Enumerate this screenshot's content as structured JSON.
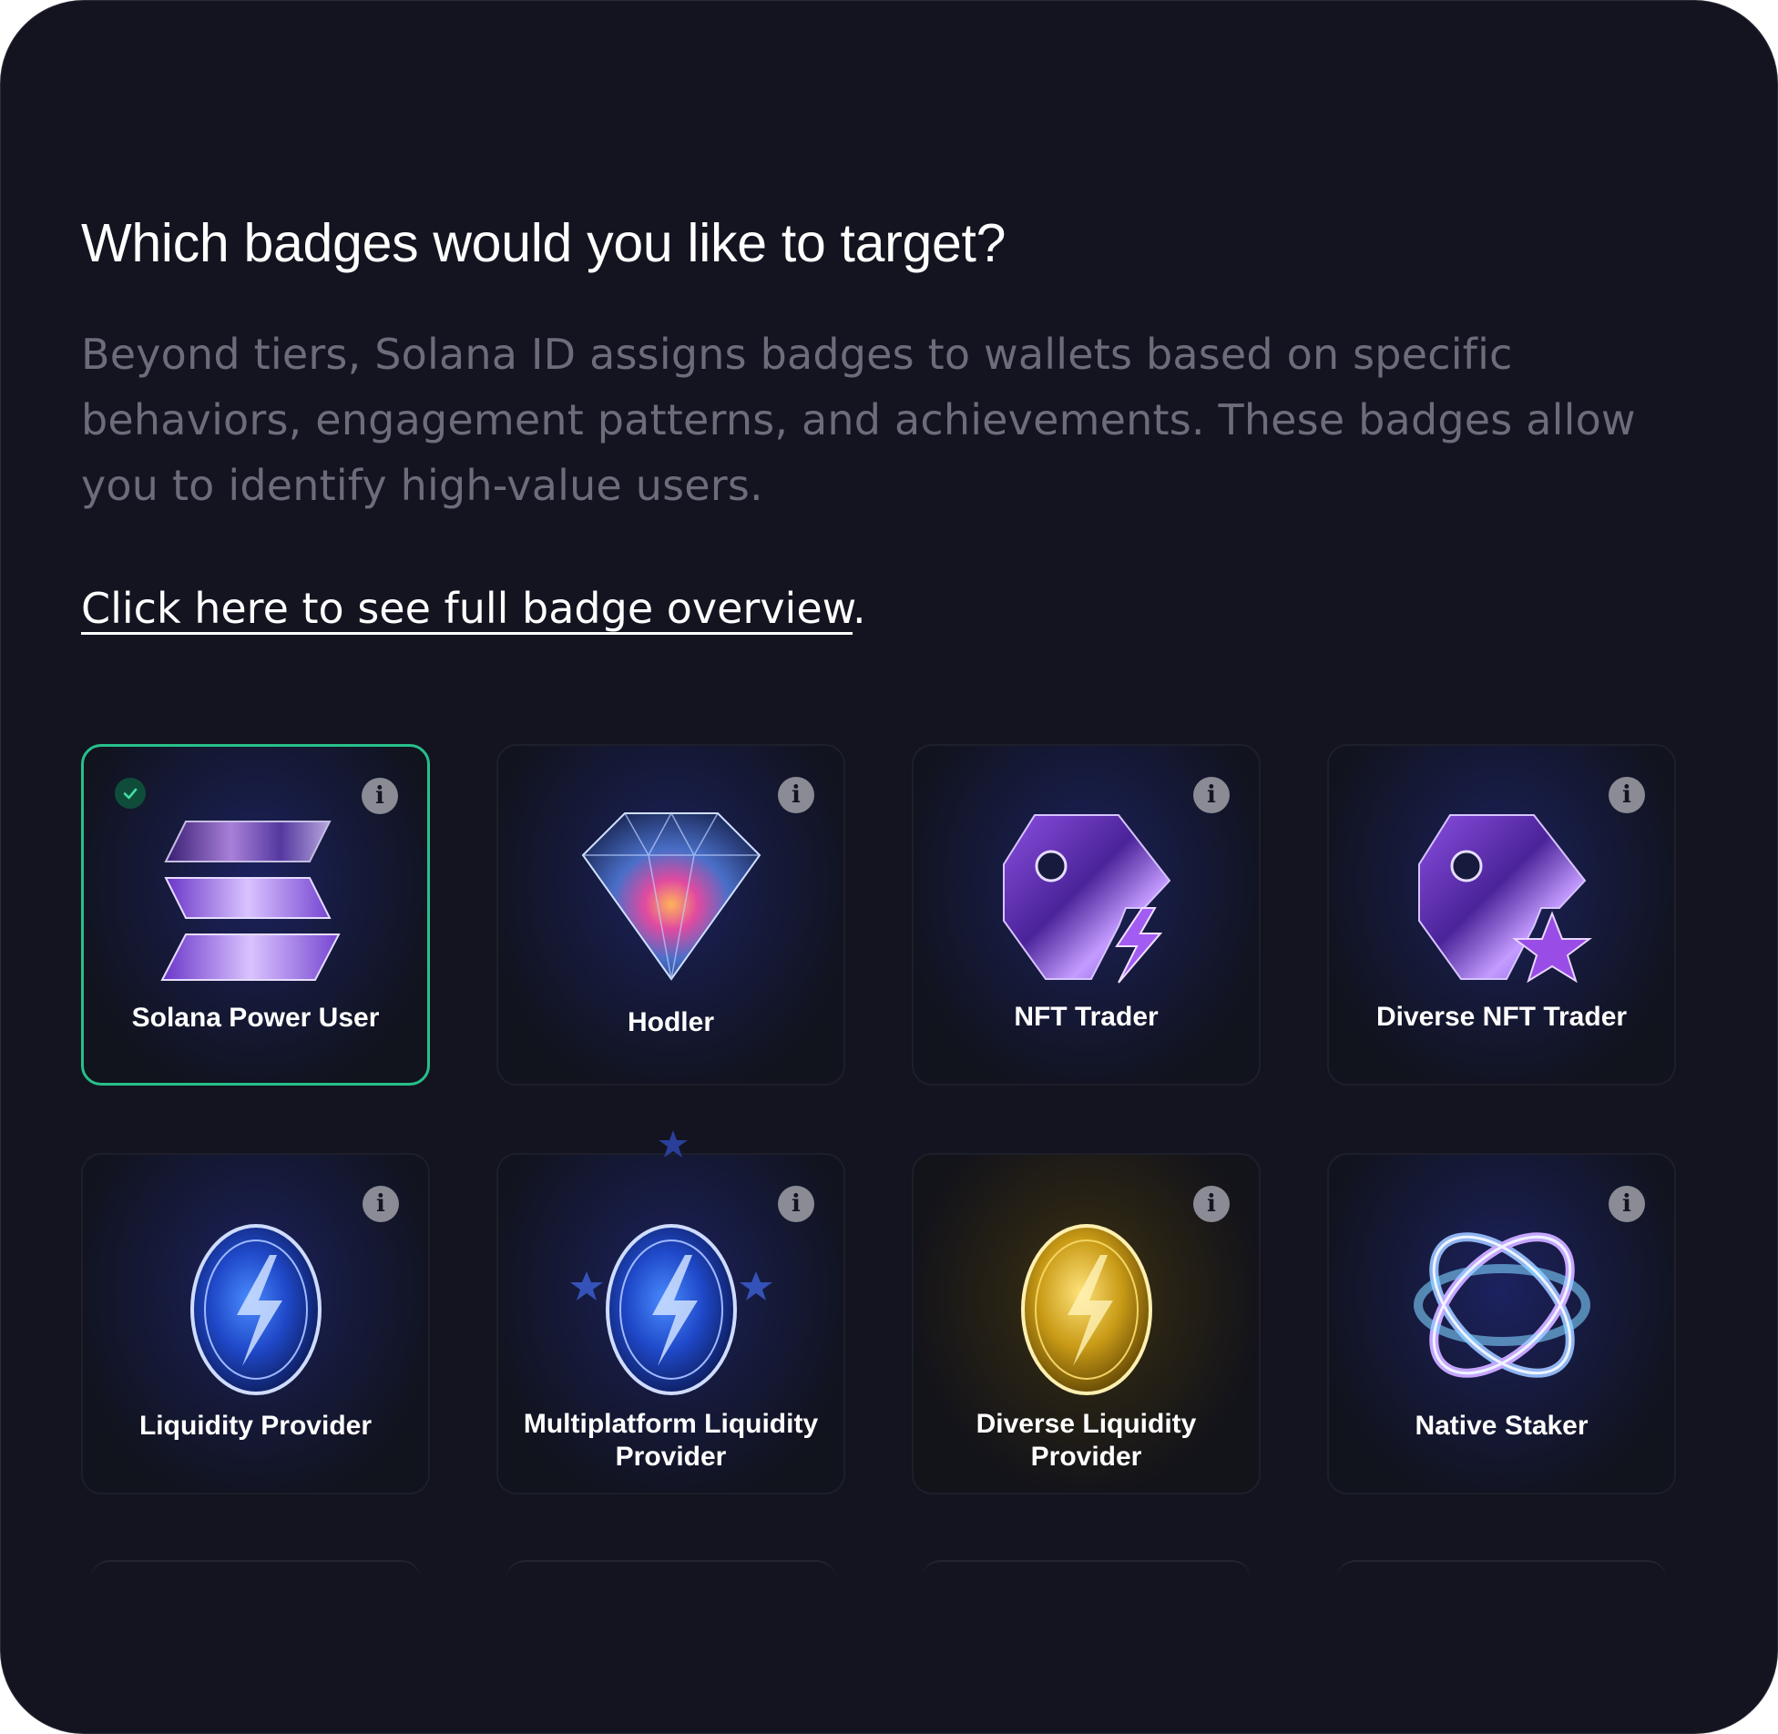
{
  "heading": "Which badges would you like to target?",
  "description": "Beyond tiers, Solana ID assigns badges to wallets based on specific behaviors, engagement patterns, and achievements. These badges allow you to identify high-value users.",
  "overview_link": {
    "text": "Click here to see full badge overview",
    "suffix": "."
  },
  "badges": [
    {
      "label": "Solana Power User",
      "selected": true,
      "icon": "solana-logo-icon"
    },
    {
      "label": "Hodler",
      "selected": false,
      "icon": "diamond-icon"
    },
    {
      "label": "NFT Trader",
      "selected": false,
      "icon": "tag-lightning-icon"
    },
    {
      "label": "Diverse NFT Trader",
      "selected": false,
      "icon": "tag-star-icon"
    },
    {
      "label": "Liquidity Provider",
      "selected": false,
      "icon": "blue-coin-icon"
    },
    {
      "label": "Multiplatform Liquidity Provider",
      "selected": false,
      "icon": "blue-coin-stars-icon"
    },
    {
      "label": "Diverse Liquidity Provider",
      "selected": false,
      "icon": "gold-coin-icon"
    },
    {
      "label": "Native Staker",
      "selected": false,
      "icon": "atom-rings-icon"
    }
  ],
  "colors": {
    "background": "#13141f",
    "selected_border": "#27c08a",
    "muted_text": "#6b6d7b",
    "info_icon": "#8a8b94"
  }
}
